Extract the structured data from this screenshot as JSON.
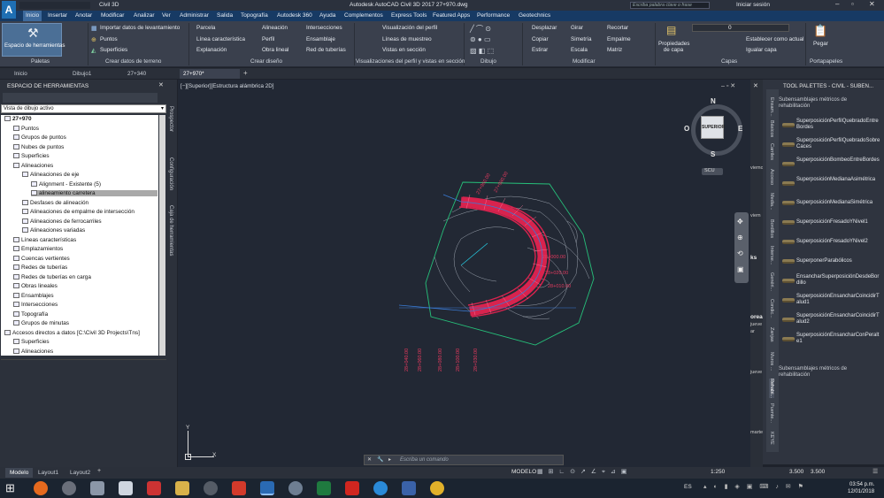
{
  "titlebar": {
    "app_name": "Civil 3D",
    "title": "Autodesk AutoCAD Civil 3D 2017    27+970.dwg",
    "search_placeholder": "Escriba palabra clave o frase",
    "signin": "Iniciar sesión"
  },
  "menu": [
    "Inicio",
    "Insertar",
    "Anotar",
    "Modificar",
    "Analizar",
    "Ver",
    "Administrar",
    "Salida",
    "Topografía",
    "Autodesk 360",
    "Ayuda",
    "Complementos",
    "Express Tools",
    "Featured Apps",
    "Performance",
    "Geotechnics"
  ],
  "ribbon": {
    "big_button": "Espacio de herramientas",
    "create_data": [
      "Importar datos de levantamiento",
      "Puntos",
      "Superficies"
    ],
    "create_design_col1": [
      "Parcela",
      "Línea característica",
      "Explanación"
    ],
    "create_design_col2": [
      "Alineación",
      "Perfil",
      "Obra lineal"
    ],
    "create_design_col3": [
      "Intersecciones",
      "Ensamblaje",
      "Red de tuberías"
    ],
    "profile_views": [
      "Visualización del perfil",
      "Líneas de muestreo",
      "Vistas en sección"
    ],
    "modify_col1": [
      "Desplazar",
      "Copiar",
      "Estirar"
    ],
    "modify_col2": [
      "Girar",
      "Simetría",
      "Escala"
    ],
    "modify_col3": [
      "Recortar",
      "Empalme",
      "Matriz"
    ],
    "layer_props": "Propiedades de capa",
    "layer_current_value": "0",
    "layer_actions": [
      "Establecer como actual",
      "Igualar capa"
    ],
    "paste": "Pegar",
    "panel_titles": [
      "Paletas",
      "Crear datos de terreno",
      "Crear diseño",
      "Visualizaciones del perfil y vistas en sección",
      "Dibujo",
      "Modificar",
      "Capas",
      "Portapapeles"
    ]
  },
  "doc_tabs": [
    "Inicio",
    "Dibujo1",
    "27+340",
    "27+970*"
  ],
  "toolspace": {
    "title": "ESPACIO DE HERRAMIENTAS",
    "view_select": "Vista de dibujo activo",
    "side_tabs": [
      "Prospector",
      "Configuración",
      "Caja de herramientas"
    ],
    "tree": [
      {
        "label": "27+970",
        "level": 0,
        "bold": true
      },
      {
        "label": "Puntos",
        "level": 1
      },
      {
        "label": "Grupos de puntos",
        "level": 1
      },
      {
        "label": "Nubes de puntos",
        "level": 1
      },
      {
        "label": "Superficies",
        "level": 1
      },
      {
        "label": "Alineaciones",
        "level": 1
      },
      {
        "label": "Alineaciones de eje",
        "level": 2
      },
      {
        "label": "Alignment - Existente (5)",
        "level": 3
      },
      {
        "label": "alineamiento carretera",
        "level": 3,
        "selected": true
      },
      {
        "label": "Desfases de alineación",
        "level": 2
      },
      {
        "label": "Alineaciones de empalme de intersección",
        "level": 2
      },
      {
        "label": "Alineaciones de ferrocarriles",
        "level": 2
      },
      {
        "label": "Alineaciones variadas",
        "level": 2
      },
      {
        "label": "Líneas características",
        "level": 1
      },
      {
        "label": "Emplazamientos",
        "level": 1
      },
      {
        "label": "Cuencas vertientes",
        "level": 1
      },
      {
        "label": "Redes de tuberías",
        "level": 1
      },
      {
        "label": "Redes de tuberías en carga",
        "level": 1
      },
      {
        "label": "Obras lineales",
        "level": 1
      },
      {
        "label": "Ensamblajes",
        "level": 1
      },
      {
        "label": "Intersecciones",
        "level": 1
      },
      {
        "label": "Topografía",
        "level": 1
      },
      {
        "label": "Grupos de minutas",
        "level": 1
      },
      {
        "label": "Accesos directos a datos [C:\\Civil 3D Projects\\Tns]",
        "level": 0
      },
      {
        "label": "Superficies",
        "level": 1
      },
      {
        "label": "Alineaciones",
        "level": 1
      }
    ]
  },
  "canvas": {
    "viewport_label": "[−][Superior][Estructura alámbrica 2D]",
    "viewcube": {
      "n": "N",
      "s": "S",
      "e": "E",
      "o": "O",
      "face": "SUPERIOR",
      "ucs": "SCU"
    },
    "command_placeholder": "Escriba un comando",
    "ucs_x": "X",
    "ucs_y": "Y",
    "stations": [
      "28+000.00",
      "28+020.00",
      "28+040.00",
      "28+060.00",
      "28+080.00",
      "28+100.00",
      "27+960.00",
      "27+980.00",
      "28+030.00",
      "28+010.00"
    ],
    "colors": {
      "corridor": "#d8234e",
      "boundary": "#26c07a",
      "contours": "#9aa2ad",
      "axis": "#3a7bd5",
      "labels": "#e23a5e"
    }
  },
  "palette": {
    "title": "TOOL PALETTES - CIVIL - SUBEN...",
    "header1": "Subensamblajes métricos de rehabilitación",
    "items": [
      "SuperposiciónPerfilQuebradoEntreBordes",
      "SuperposiciónPerfilQuebradoSobreCaces",
      "SuperposiciónBombeoEntreBordes",
      "SuperposiciónMedianaAsimétrica",
      "SuperposiciónMedianaSimétrica",
      "SuperposiciónFresadoYNivel1",
      "SuperposiciónFresadoYNivel2",
      "SuperponerParabólicos",
      "EnsancharSuperposiciónDesdeBordillo",
      "SuperposiciónEnsancharCoincidirTalud1",
      "SuperposiciónEnsancharCoincidirTalud2",
      "SuperposiciónEnsancharConPeralte1"
    ],
    "footer": "Subensamblajes métricos de rehabilitación",
    "tabs": [
      "Ensam...",
      "Básicos",
      "Carriles",
      "Acceso",
      "Media...",
      "Bordillos",
      "Interse...",
      "Genéri...",
      "Condic...",
      "Zanjas",
      "Muros ...",
      "Rehabi...",
      "Puente...",
      "KEYE"
    ],
    "partial_texts": [
      "viemo",
      "viem",
      "ks",
      "orear",
      "jueve",
      "ar",
      "jueve",
      "marte"
    ]
  },
  "status": {
    "layout_tabs": [
      "Modelo",
      "Layout1",
      "Layout2"
    ],
    "mode": "MODELO",
    "scale": "1:250",
    "value1": "3.500",
    "value2": "3.500"
  },
  "taskbar": {
    "lang": "ES",
    "time": "03:54 p.m.",
    "date": "12/01/2018"
  }
}
